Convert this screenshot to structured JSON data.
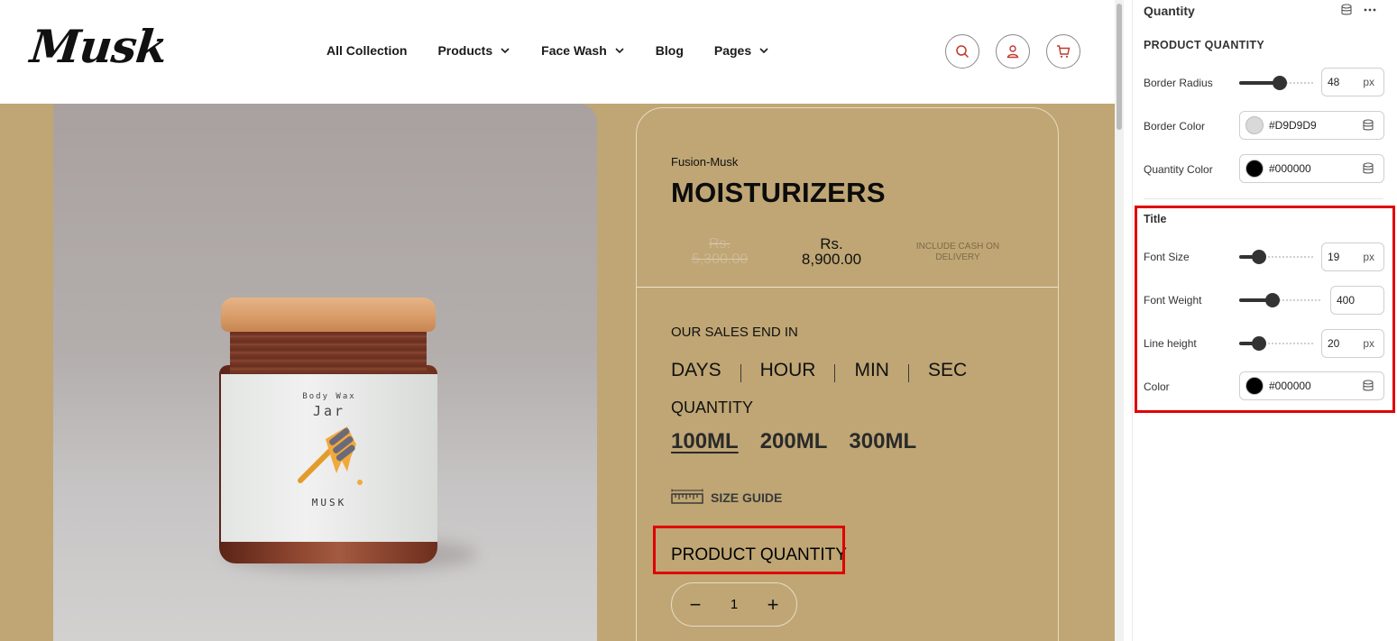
{
  "brand": {
    "logo": "Musk"
  },
  "nav": {
    "items": [
      {
        "label": "All Collection",
        "dropdown": false
      },
      {
        "label": "Products",
        "dropdown": true
      },
      {
        "label": "Face Wash",
        "dropdown": true
      },
      {
        "label": "Blog",
        "dropdown": false
      },
      {
        "label": "Pages",
        "dropdown": true
      }
    ],
    "icons": [
      "search-icon",
      "user-icon",
      "cart-icon"
    ]
  },
  "product": {
    "vendor": "Fusion-Musk",
    "title": "MOISTURIZERS",
    "price_old": "Rs. 5,300.00",
    "price_new": "Rs. 8,900.00",
    "price_note": "INCLUDE CASH ON DELIVERY",
    "sales_end_label": "OUR SALES END IN",
    "countdown": [
      "DAYS",
      "HOUR",
      "MIN",
      "SEC"
    ],
    "quantity_label": "QUANTITY",
    "sizes": [
      {
        "label": "100ML",
        "selected": true
      },
      {
        "label": "200ML",
        "selected": false
      },
      {
        "label": "300ML",
        "selected": false
      }
    ],
    "size_guide_label": "SIZE GUIDE",
    "product_quantity_title": "PRODUCT QUANTITY",
    "quantity_value": "1",
    "quantity_minus": "−",
    "quantity_plus": "+",
    "jar_label": {
      "line1": "Body Wax",
      "line2": "Jar",
      "line3": "MUSK"
    }
  },
  "panel": {
    "header": "Quantity",
    "section_title": "PRODUCT QUANTITY",
    "border_radius": {
      "label": "Border Radius",
      "value": "48",
      "unit": "px",
      "level": 0.55
    },
    "border_color": {
      "label": "Border Color",
      "value": "#D9D9D9",
      "swatch": "#D9D9D9"
    },
    "quantity_color": {
      "label": "Quantity Color",
      "value": "#000000",
      "swatch": "#000000"
    },
    "title_section": "Title",
    "font_size": {
      "label": "Font Size",
      "value": "19",
      "unit": "px",
      "level": 0.27
    },
    "font_weight": {
      "label": "Font Weight",
      "value": "400",
      "level": 0.4
    },
    "line_height": {
      "label": "Line height",
      "value": "20",
      "unit": "px",
      "level": 0.27
    },
    "title_color": {
      "label": "Color",
      "value": "#000000",
      "swatch": "#000000"
    }
  },
  "colors": {
    "page_bg": "#bfa674",
    "highlight": "#e00000",
    "accent_icon": "#c0392b"
  }
}
